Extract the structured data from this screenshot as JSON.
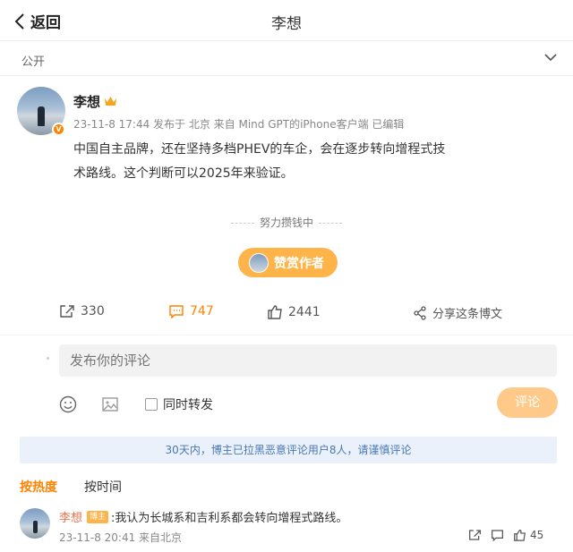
{
  "nav": {
    "back_label": "返回",
    "title": "李想"
  },
  "visibility": {
    "label": "公开"
  },
  "post": {
    "author": "李想",
    "meta": "23-11-8 17:44  发布于 北京  来自 Mind GPT的iPhone客户端  已编辑",
    "text": "中国自主品牌，还在坚持多档PHEV的车企，会在逐步转向增程式技术路线。这个判断可以2025年来验证。"
  },
  "reward": {
    "hint": "努力攒钱中",
    "button_label": "赞赏作者"
  },
  "actions": {
    "repost": "330",
    "comment": "747",
    "like": "2441",
    "share": "分享这条博文"
  },
  "comment_box": {
    "placeholder": "发布你的评论",
    "repost_label": "同时转发",
    "submit_label": "评论"
  },
  "notice": "30天内，博主已拉黑恶意评论用户8人，请谨慎评论",
  "sort": {
    "hot": "按热度",
    "time": "按时间"
  },
  "comments": [
    {
      "author": "李想",
      "badge": "博主",
      "text": ":我认为长城系和吉利系都会转向增程式路线。",
      "meta": "23-11-8 20:41 来自北京",
      "likes": "45"
    }
  ],
  "colors": {
    "accent": "#ff8200",
    "notice_bg": "#eaf1fb",
    "notice_text": "#4a78b4",
    "reward_btn": "#ffb44a"
  },
  "icons": [
    "chevron-left-icon",
    "chevron-down-icon",
    "crown-icon",
    "verified-icon",
    "repost-icon",
    "comment-icon",
    "like-icon",
    "share-icon",
    "emoji-icon",
    "image-icon"
  ]
}
